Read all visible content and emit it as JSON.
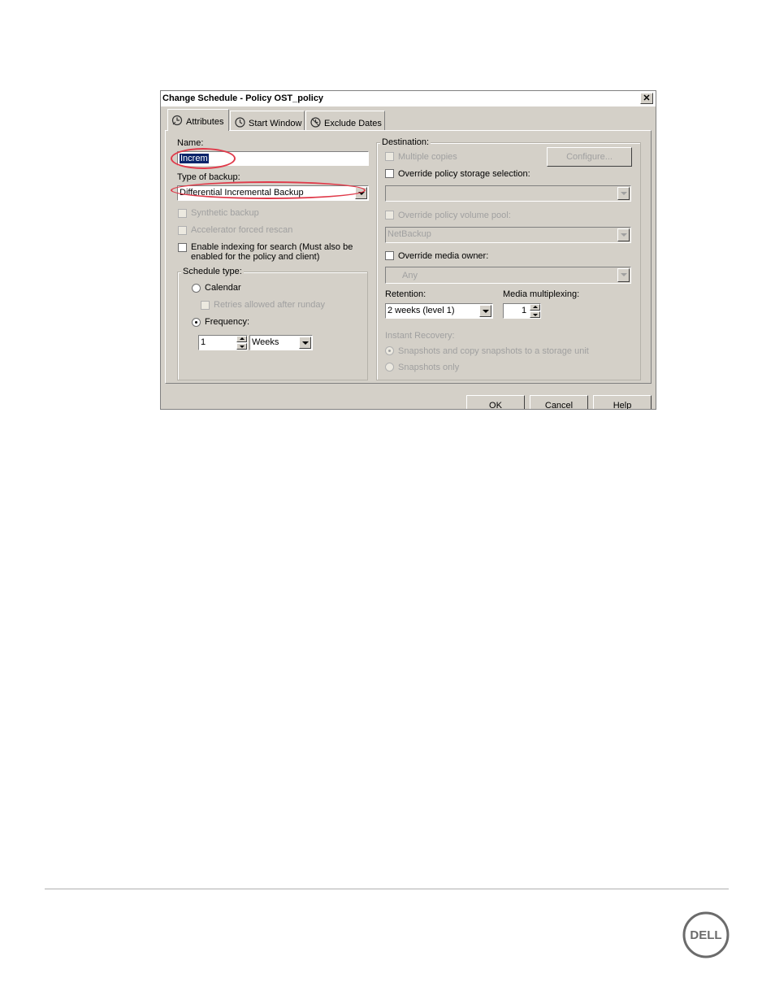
{
  "dialog": {
    "title": "Change Schedule - Policy OST_policy",
    "close_glyph": "✕",
    "tabs": [
      {
        "label": "Attributes",
        "icon": "schedule-attributes-icon"
      },
      {
        "label": "Start Window",
        "icon": "start-window-icon"
      },
      {
        "label": "Exclude Dates",
        "icon": "exclude-dates-icon"
      }
    ],
    "buttons": {
      "ok": "OK",
      "cancel": "Cancel",
      "help": "Help"
    }
  },
  "attributes": {
    "name_label": "Name:",
    "name_value": "Increm",
    "type_label": "Type of backup:",
    "type_value": "Differential Incremental Backup",
    "synthetic_backup": "Synthetic backup",
    "accelerator_rescan": "Accelerator forced rescan",
    "enable_indexing_line1": "Enable indexing for search (Must also be",
    "enable_indexing_line2": "enabled for the policy and client)",
    "schedule_type": {
      "legend": "Schedule type:",
      "calendar": "Calendar",
      "retries": "Retries allowed after runday",
      "frequency": "Frequency:",
      "frequency_value": "1",
      "frequency_unit": "Weeks"
    }
  },
  "destination": {
    "legend": "Destination:",
    "multiple_copies": "Multiple copies",
    "configure_button": "Configure...",
    "override_storage": "Override policy storage selection:",
    "storage_value": "",
    "override_volume_pool": "Override policy volume pool:",
    "volume_pool_value": "NetBackup",
    "override_media_owner": "Override media owner:",
    "media_owner_value": "Any",
    "retention_label": "Retention:",
    "retention_value": "2 weeks (level 1)",
    "multiplexing_label": "Media multiplexing:",
    "multiplexing_value": "1",
    "instant_recovery": "Instant Recovery:",
    "snapshots_copy": "Snapshots and copy snapshots to a storage unit",
    "snapshots_only": "Snapshots only"
  },
  "footer": {
    "logo_text": "DELL",
    "logo_icon": "dell-logo"
  },
  "colors": {
    "dialog_bg": "#d4d0c8",
    "highlight_ellipse": "#e03a4a",
    "selection": "#0a246a"
  }
}
